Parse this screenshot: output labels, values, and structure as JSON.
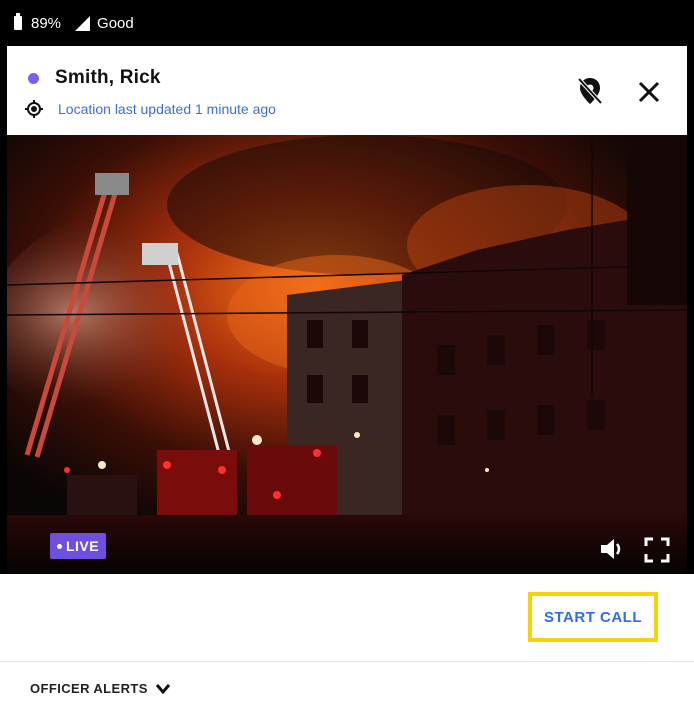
{
  "status_bar": {
    "battery": "89%",
    "signal": "Good"
  },
  "header": {
    "officer_name": "Smith, Rick",
    "location_status": "Location last updated 1 minute ago",
    "icons": [
      "crosshair-icon",
      "location-off-icon",
      "close-icon"
    ]
  },
  "video": {
    "live_label": "LIVE",
    "icons": [
      "volume-icon",
      "fullscreen-icon"
    ]
  },
  "actions": {
    "start_call_label": "START CALL"
  },
  "alerts": {
    "label": "OFFICER ALERTS"
  },
  "colors": {
    "presence": "#7b61e8",
    "link_blue": "#3a6fd8",
    "live_badge": "#6f4fe0",
    "highlight": "#f5d20a",
    "button_text": "#2f6de0"
  }
}
